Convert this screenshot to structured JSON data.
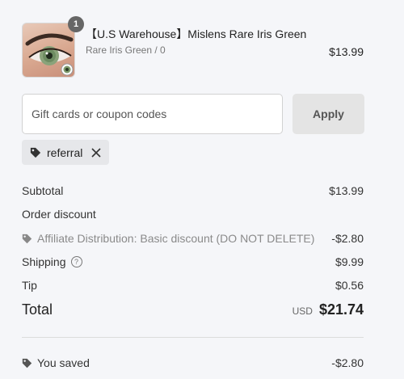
{
  "product": {
    "title": "【U.S Warehouse】Mislens Rare Iris Green",
    "variant": "Rare Iris Green / 0",
    "price": "$13.99",
    "quantity": "1"
  },
  "coupon": {
    "placeholder": "Gift cards or coupon codes",
    "apply_label": "Apply",
    "applied_tag": "referral"
  },
  "summary": {
    "subtotal_label": "Subtotal",
    "subtotal_value": "$13.99",
    "order_discount_label": "Order discount",
    "discount_name": "Affiliate Distribution: Basic discount (DO NOT DELETE)",
    "discount_value": "-$2.80",
    "shipping_label": "Shipping",
    "shipping_value": "$9.99",
    "tip_label": "Tip",
    "tip_value": "$0.56",
    "total_label": "Total",
    "currency": "USD",
    "total_value": "$21.74",
    "saved_label": "You saved",
    "saved_value": "-$2.80"
  },
  "icons": {
    "tag": "tag-icon",
    "close": "close-icon",
    "help": "help-icon"
  }
}
